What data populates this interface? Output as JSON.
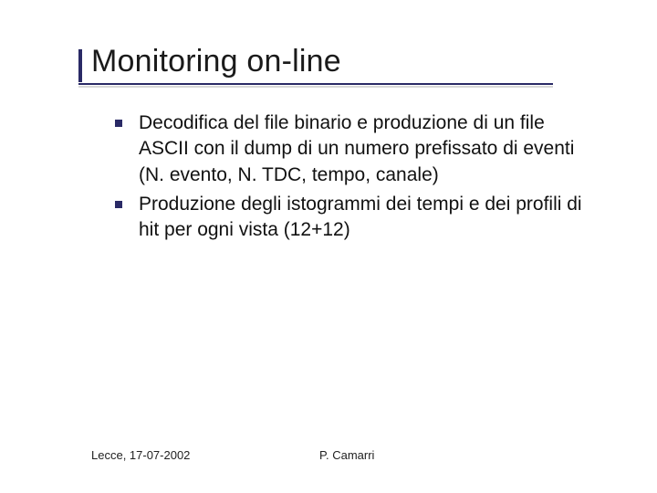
{
  "slide": {
    "title": "Monitoring on-line",
    "bullets": [
      "Decodifica del file binario e produzione di un file ASCII con il dump di un numero prefissato di eventi (N. evento, N. TDC, tempo, canale)",
      "Produzione degli istogrammi dei tempi e dei profili di hit per ogni vista (12+12)"
    ],
    "footer": {
      "location_date": "Lecce, 17-07-2002",
      "author": "P. Camarri"
    }
  }
}
